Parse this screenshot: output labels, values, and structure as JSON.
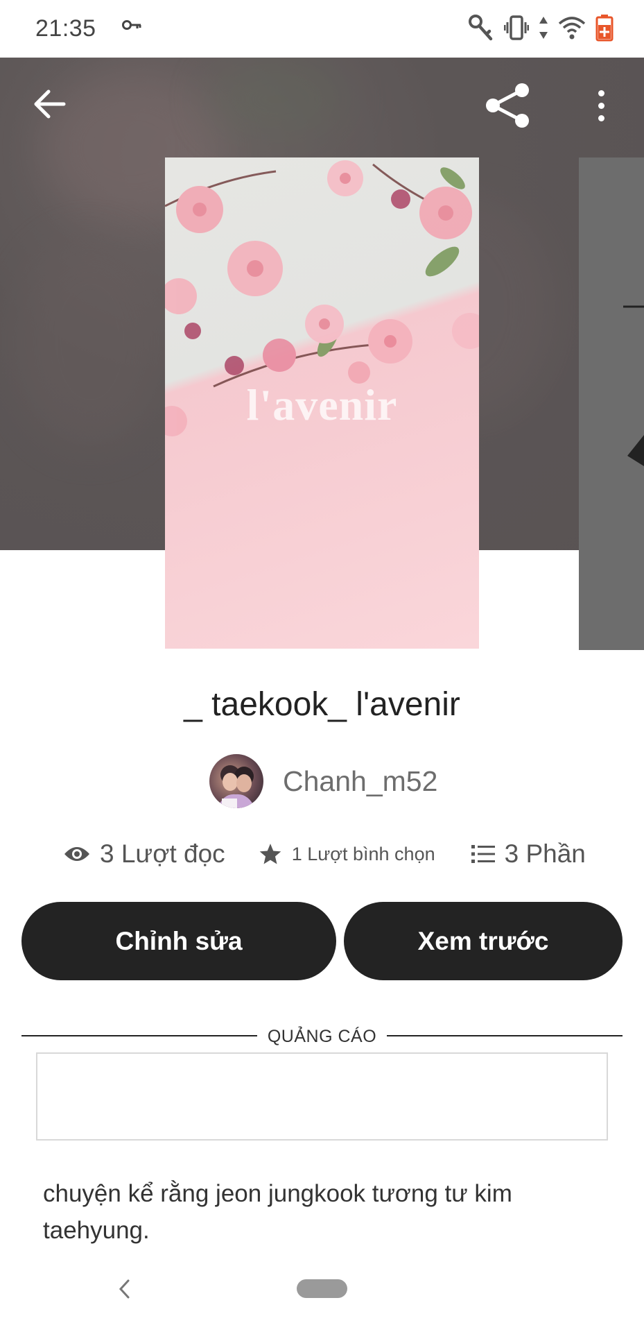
{
  "status_bar": {
    "time": "21:35",
    "icons": [
      "vpn-key-icon",
      "key-icon",
      "vibrate-icon",
      "data-arrows-icon",
      "wifi-icon",
      "battery-icon"
    ],
    "battery_color": "#e8562a"
  },
  "header": {
    "back_icon": "arrow-left-icon",
    "share_icon": "share-icon",
    "more_icon": "more-vertical-icon"
  },
  "cover": {
    "title_text": "l'avenir"
  },
  "story": {
    "title": "_ taekook_ l'avenir",
    "author": "Chanh_m52"
  },
  "stats": {
    "reads": "3 Lượt đọc",
    "votes": "1 Lượt bình chọn",
    "parts": "3 Phần"
  },
  "actions": {
    "edit_label": "Chỉnh sửa",
    "preview_label": "Xem trước"
  },
  "ad": {
    "label": "QUẢNG CÁO"
  },
  "description": "chuyện kể rằng jeon jungkook tương tư kim taehyung.",
  "colors": {
    "button_bg": "#232323",
    "header_bg": "#5c5656",
    "cover_pink": "#fad6da"
  }
}
